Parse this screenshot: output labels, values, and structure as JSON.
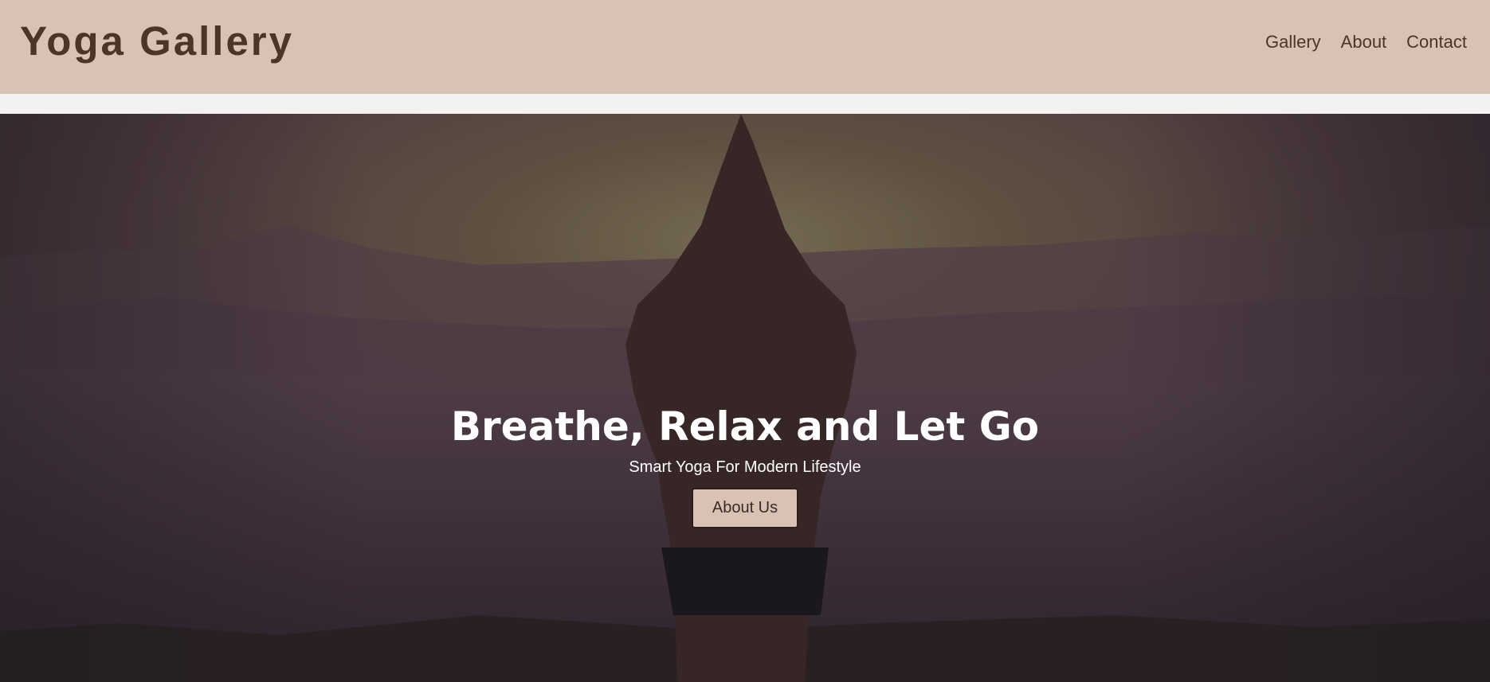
{
  "header": {
    "logo": "Yoga Gallery",
    "nav": [
      {
        "label": "Gallery"
      },
      {
        "label": "About"
      },
      {
        "label": "Contact"
      }
    ]
  },
  "hero": {
    "title": "Breathe, Relax and Let Go",
    "subtitle": "Smart Yoga For Modern Lifestyle",
    "button_label": "About Us",
    "image_description_icon": "yoga-pose-background"
  },
  "colors": {
    "header_bg": "#d8c2b6",
    "text_dark": "#4a3526",
    "button_bg": "#d8c2b6",
    "hero_overlay": "#3a2e32"
  }
}
